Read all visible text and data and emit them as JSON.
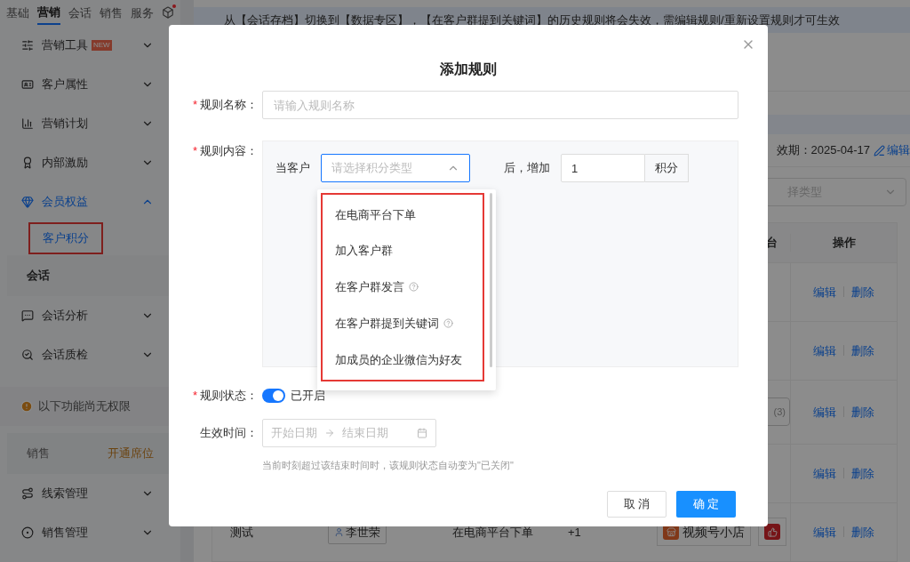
{
  "top_tabs": [
    {
      "label": "基础",
      "selected": false
    },
    {
      "label": "营销",
      "selected": true
    },
    {
      "label": "会话",
      "selected": false
    },
    {
      "label": "销售",
      "selected": false
    },
    {
      "label": "服务",
      "selected": false
    }
  ],
  "sidebar": [
    {
      "kind": "item",
      "label": "营销工具",
      "badge": "NEW",
      "expanded": false
    },
    {
      "kind": "item",
      "label": "客户属性",
      "expanded": false
    },
    {
      "kind": "item",
      "label": "营销计划",
      "expanded": false
    },
    {
      "kind": "item",
      "label": "内部激励",
      "expanded": false
    },
    {
      "kind": "item",
      "label": "会员权益",
      "expanded": true
    },
    {
      "kind": "subitem",
      "label": "客户积分",
      "selected": true,
      "highlighted": true
    },
    {
      "kind": "section",
      "label": "会话"
    },
    {
      "kind": "item",
      "label": "会话分析",
      "expanded": false
    },
    {
      "kind": "item",
      "label": "会话质检",
      "expanded": false
    },
    {
      "kind": "notice",
      "label": "以下功能尚无权限"
    },
    {
      "kind": "section",
      "label": "销售",
      "action": "开通席位"
    },
    {
      "kind": "item",
      "label": "线索管理",
      "expanded": false
    },
    {
      "kind": "item",
      "label": "销售管理",
      "expanded": false
    }
  ],
  "banner": "从【会话存档】切换到【数据专区】，【在客户群提到关键词】的历史规则将会失效，需编辑规则/重新设置规则才可生效",
  "expiry": "效期：2025-04-17",
  "expiry_edit": "编辑",
  "type_select": {
    "placeholder": "择类型"
  },
  "table": {
    "columns": [
      "台",
      "操作"
    ],
    "rows": [
      {
        "actions": [
          "编辑",
          "删除"
        ]
      },
      {
        "actions": [
          "编辑",
          "删除"
        ]
      },
      {
        "count": "(3)",
        "actions": [
          "编辑",
          "删除"
        ]
      },
      {
        "actions": [
          "编辑",
          "删除"
        ]
      },
      {
        "name": "测试",
        "owner": "李世荣",
        "event": "在电商平台下单",
        "points": "+1",
        "platforms": [
          {
            "kind": "store",
            "label": "视频号小店"
          },
          {
            "kind": "thumbs"
          }
        ],
        "actions": [
          "编辑",
          "删除"
        ]
      }
    ]
  },
  "dialog": {
    "title": "添加规则",
    "required_mark": "*",
    "name_field": {
      "label": "规则名称：",
      "required": true,
      "placeholder": "请输入规则名称"
    },
    "content": {
      "label": "规则内容：",
      "required": true,
      "prefix": "当客户",
      "select": {
        "placeholder": "请选择积分类型",
        "expanded": true
      },
      "middle": "后，增加",
      "points": "1",
      "unit": "积分"
    },
    "options": {
      "highlighted": true,
      "items": [
        {
          "label": "在电商平台下单",
          "help": false
        },
        {
          "label": "加入客户群",
          "help": false
        },
        {
          "label": "在客户群发言",
          "help": true
        },
        {
          "label": "在客户群提到关键词",
          "help": true
        },
        {
          "label": "加成员的企业微信为好友",
          "help": false
        }
      ]
    },
    "status": {
      "label": "规则状态：",
      "required": true,
      "on": true,
      "text": "已开启"
    },
    "period": {
      "label": "生效时间：",
      "required": false,
      "start_placeholder": "开始日期",
      "end_placeholder": "结束日期",
      "hint": "当前时刻超过该结束时间时，该规则状态自动变为\"已关闭\""
    },
    "buttons": [
      "取 消",
      "确 定"
    ]
  }
}
